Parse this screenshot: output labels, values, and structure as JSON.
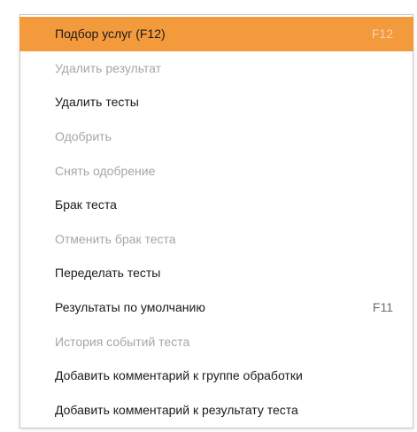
{
  "menu": {
    "items": [
      {
        "label": "Подбор услуг (F12)",
        "shortcut": "F12",
        "enabled": true,
        "highlighted": true
      },
      {
        "label": "Удалить результат",
        "shortcut": "",
        "enabled": false,
        "highlighted": false
      },
      {
        "label": "Удалить тесты",
        "shortcut": "",
        "enabled": true,
        "highlighted": false
      },
      {
        "label": "Одобрить",
        "shortcut": "",
        "enabled": false,
        "highlighted": false
      },
      {
        "label": "Снять одобрение",
        "shortcut": "",
        "enabled": false,
        "highlighted": false
      },
      {
        "label": "Брак теста",
        "shortcut": "",
        "enabled": true,
        "highlighted": false
      },
      {
        "label": "Отменить брак теста",
        "shortcut": "",
        "enabled": false,
        "highlighted": false
      },
      {
        "label": "Переделать тесты",
        "shortcut": "",
        "enabled": true,
        "highlighted": false
      },
      {
        "label": "Результаты по умолчанию",
        "shortcut": "F11",
        "enabled": true,
        "highlighted": false
      },
      {
        "label": "История событий теста",
        "shortcut": "",
        "enabled": false,
        "highlighted": false
      },
      {
        "label": "Добавить комментарий к группе обработки",
        "shortcut": "",
        "enabled": true,
        "highlighted": false
      },
      {
        "label": "Добавить комментарий к результату теста",
        "shortcut": "",
        "enabled": true,
        "highlighted": false
      }
    ],
    "colors": {
      "highlight": "#f39a3c",
      "enabled_text": "#1a1a1a",
      "disabled_text": "#a6a6a6"
    }
  }
}
